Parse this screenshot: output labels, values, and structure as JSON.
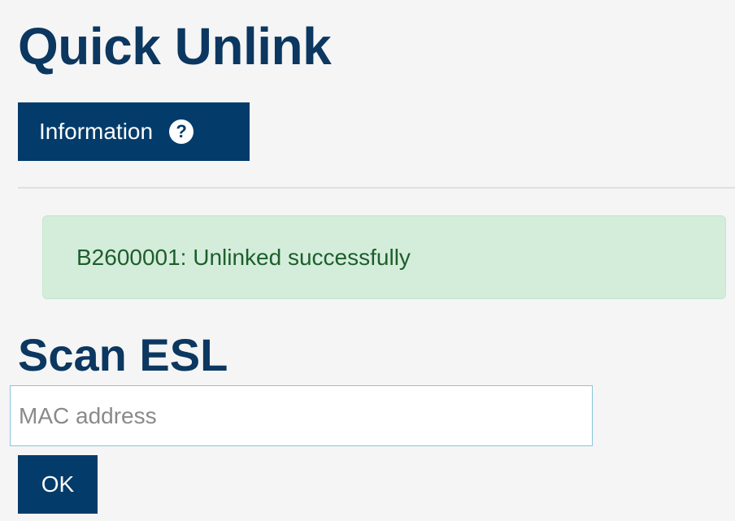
{
  "page": {
    "title": "Quick Unlink"
  },
  "info_button": {
    "label": "Information",
    "icon": "question-circle-icon",
    "icon_glyph": "?"
  },
  "alert": {
    "message": "B2600001: Unlinked successfully"
  },
  "scan": {
    "title": "Scan ESL",
    "input_value": "",
    "input_placeholder": "MAC address",
    "ok_label": "OK"
  },
  "colors": {
    "primary": "#033c6b",
    "heading": "#0b3760",
    "success_bg": "#d4eddb",
    "success_text": "#1e5e2c",
    "input_border": "#86c5de"
  }
}
